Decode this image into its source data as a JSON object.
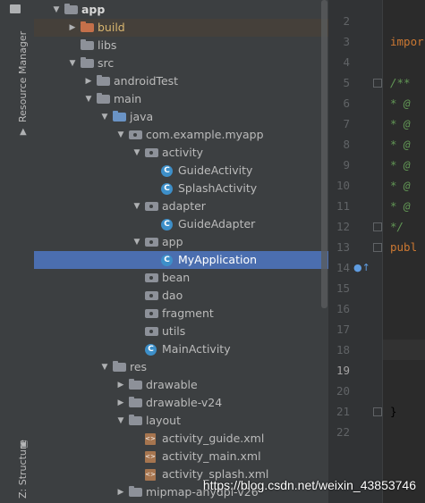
{
  "side_tabs": {
    "resource_manager": "Resource Manager",
    "structure": "Z: Structure"
  },
  "tree": [
    {
      "label": "app",
      "indent": 0,
      "arrow": "down",
      "icon": "app",
      "bold": true
    },
    {
      "label": "build",
      "indent": 1,
      "arrow": "right",
      "icon": "folder-orange",
      "highlight": "build"
    },
    {
      "label": "libs",
      "indent": 1,
      "arrow": "",
      "icon": "folder"
    },
    {
      "label": "src",
      "indent": 1,
      "arrow": "down",
      "icon": "folder"
    },
    {
      "label": "androidTest",
      "indent": 2,
      "arrow": "right",
      "icon": "folder"
    },
    {
      "label": "main",
      "indent": 2,
      "arrow": "down",
      "icon": "folder"
    },
    {
      "label": "java",
      "indent": 3,
      "arrow": "down",
      "icon": "folder-blue"
    },
    {
      "label": "com.example.myapp",
      "indent": 4,
      "arrow": "down",
      "icon": "package"
    },
    {
      "label": "activity",
      "indent": 5,
      "arrow": "down",
      "icon": "package"
    },
    {
      "label": "GuideActivity",
      "indent": 6,
      "arrow": "",
      "icon": "class"
    },
    {
      "label": "SplashActivity",
      "indent": 6,
      "arrow": "",
      "icon": "class"
    },
    {
      "label": "adapter",
      "indent": 5,
      "arrow": "down",
      "icon": "package"
    },
    {
      "label": "GuideAdapter",
      "indent": 6,
      "arrow": "",
      "icon": "class"
    },
    {
      "label": "app",
      "indent": 5,
      "arrow": "down",
      "icon": "package"
    },
    {
      "label": "MyApplication",
      "indent": 6,
      "arrow": "",
      "icon": "class",
      "selected": true
    },
    {
      "label": "bean",
      "indent": 5,
      "arrow": "",
      "icon": "package"
    },
    {
      "label": "dao",
      "indent": 5,
      "arrow": "",
      "icon": "package"
    },
    {
      "label": "fragment",
      "indent": 5,
      "arrow": "",
      "icon": "package"
    },
    {
      "label": "utils",
      "indent": 5,
      "arrow": "",
      "icon": "package"
    },
    {
      "label": "MainActivity",
      "indent": 5,
      "arrow": "",
      "icon": "class"
    },
    {
      "label": "res",
      "indent": 3,
      "arrow": "down",
      "icon": "folder"
    },
    {
      "label": "drawable",
      "indent": 4,
      "arrow": "right",
      "icon": "folder"
    },
    {
      "label": "drawable-v24",
      "indent": 4,
      "arrow": "right",
      "icon": "folder"
    },
    {
      "label": "layout",
      "indent": 4,
      "arrow": "down",
      "icon": "folder"
    },
    {
      "label": "activity_guide.xml",
      "indent": 5,
      "arrow": "",
      "icon": "xml"
    },
    {
      "label": "activity_main.xml",
      "indent": 5,
      "arrow": "",
      "icon": "xml"
    },
    {
      "label": "activity_splash.xml",
      "indent": 5,
      "arrow": "",
      "icon": "xml"
    },
    {
      "label": "mipmap-anydpi-v26",
      "indent": 4,
      "arrow": "right",
      "icon": "folder"
    }
  ],
  "line_numbers": [
    "2",
    "3",
    "4",
    "5",
    "6",
    "7",
    "8",
    "9",
    "10",
    "11",
    "12",
    "13",
    "14",
    "15",
    "16",
    "17",
    "18",
    "19",
    "20",
    "21",
    "22"
  ],
  "current_line": "19",
  "code_lines": [
    {
      "line": "3",
      "text": "impor",
      "cls": "kw"
    },
    {
      "line": "5",
      "text": "/**",
      "cls": "cm"
    },
    {
      "line": "6",
      "text": " * @",
      "cls": "cm"
    },
    {
      "line": "7",
      "text": " * @",
      "cls": "cm"
    },
    {
      "line": "8",
      "text": " * @",
      "cls": "cm"
    },
    {
      "line": "9",
      "text": " * @",
      "cls": "cm"
    },
    {
      "line": "10",
      "text": " * @",
      "cls": "cm"
    },
    {
      "line": "11",
      "text": " * @",
      "cls": "cm"
    },
    {
      "line": "12",
      "text": " */",
      "cls": "cm"
    },
    {
      "line": "13",
      "text": "publ",
      "cls": "kw"
    },
    {
      "line": "21",
      "text": "}",
      "cls": ""
    }
  ],
  "watermark": "https://blog.csdn.net/weixin_43853746"
}
